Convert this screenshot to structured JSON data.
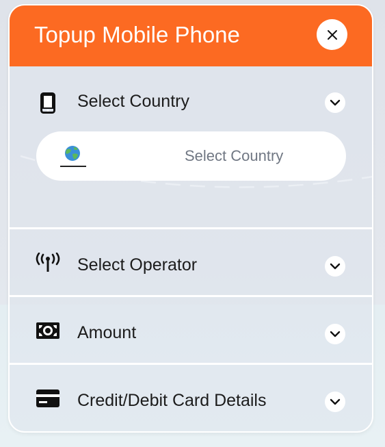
{
  "header": {
    "title": "Topup Mobile Phone",
    "close_icon": "close-icon"
  },
  "sections": [
    {
      "label": "Select Country",
      "icon": "mobile-phone-icon",
      "expanded": true
    },
    {
      "label": "Select Operator",
      "icon": "antenna-icon",
      "expanded": false
    },
    {
      "label": "Amount",
      "icon": "cash-icon",
      "expanded": false
    },
    {
      "label": "Credit/Debit Card Details",
      "icon": "credit-card-icon",
      "expanded": false
    }
  ],
  "country_select": {
    "placeholder": "Select Country",
    "icon": "globe-icon"
  },
  "colors": {
    "accent": "#fc6a22",
    "panel_border": "#ffffff",
    "text": "#1c1c1c",
    "placeholder": "#707783"
  }
}
